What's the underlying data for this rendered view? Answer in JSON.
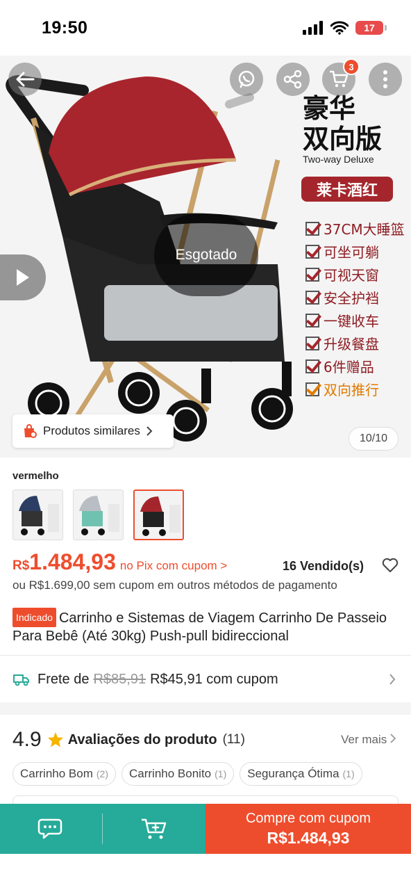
{
  "status_bar": {
    "time": "19:50",
    "battery": "17"
  },
  "header": {
    "cart_count": "3"
  },
  "hero": {
    "brand_title_line1": "豪华",
    "brand_title_line2": "双向版",
    "brand_subtitle": "Two-way Deluxe",
    "color_badge": "莱卡酒红",
    "features": [
      "37CM大睡篮",
      "可坐可躺",
      "可视天窗",
      "安全护裆",
      "一键收车",
      "升级餐盘",
      "6件赠品",
      "双向推行"
    ],
    "sold_out_label": "Esgotado",
    "similar_products_label": "Produtos similares",
    "image_counter": "10/10"
  },
  "variant": {
    "label": "vermelho",
    "options": [
      "blue",
      "grey",
      "red"
    ],
    "selected": 2
  },
  "price": {
    "currency": "R$",
    "value": "1.484,93",
    "pix_label": "no Pix com cupom >",
    "sold": "16 Vendido(s)",
    "alt_price": "ou R$1.699,00 sem cupom em outros métodos de pagamento"
  },
  "product": {
    "tag": "Indicado",
    "title": "Carrinho e Sistemas de Viagem Carrinho De Passeio Para Bebê  (Até 30kg) Push-pull bidireccional"
  },
  "shipping": {
    "prefix": "Frete de",
    "old_price": "R$85,91",
    "new_price": "R$45,91 com cupom"
  },
  "reviews": {
    "rating": "4.9",
    "label": "Avaliações do produto",
    "count": "(11)",
    "see_more": "Ver mais",
    "chips": [
      {
        "label": "Carrinho Bom",
        "count": "(2)"
      },
      {
        "label": "Carrinho Bonito",
        "count": "(1)"
      },
      {
        "label": "Segurança Ótima",
        "count": "(1)"
      }
    ]
  },
  "bottom_bar": {
    "buy_label": "Compre com cupom",
    "buy_price": "R$1.484,93"
  },
  "colors": {
    "accent": "#ee4d2d",
    "teal": "#26aa99",
    "stroller_red": "#a4262c"
  }
}
